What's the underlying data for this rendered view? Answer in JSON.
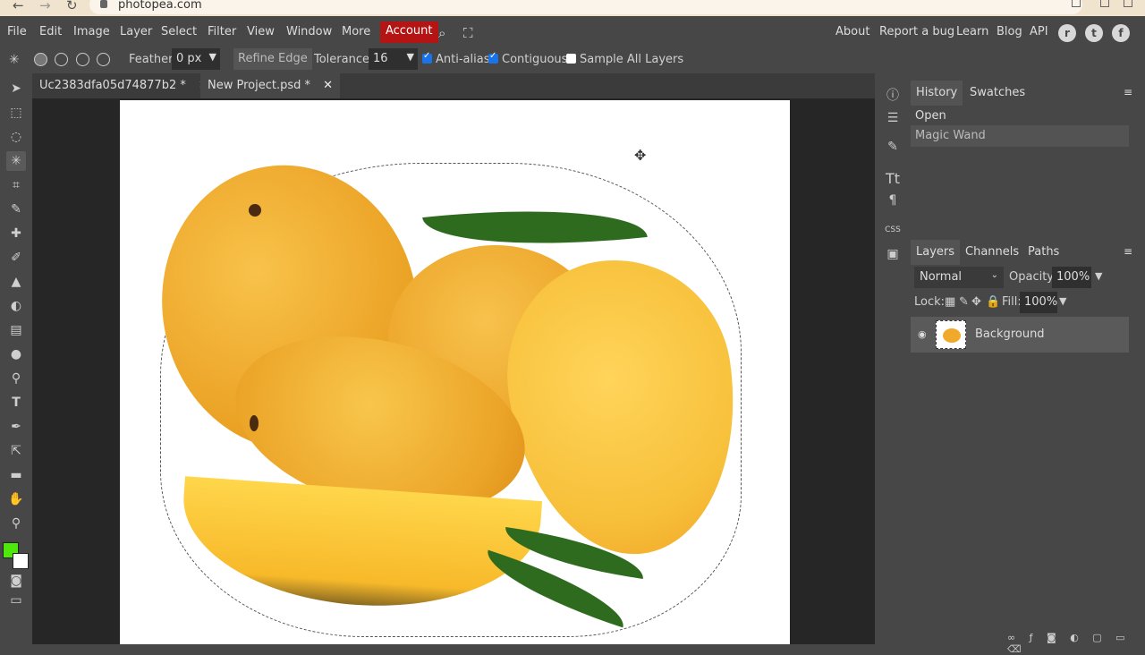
{
  "browser": {
    "url": "photopea.com"
  },
  "menu": {
    "items": [
      "File",
      "Edit",
      "Image",
      "Layer",
      "Select",
      "Filter",
      "View",
      "Window",
      "More"
    ],
    "account": "Account",
    "right_links": [
      "About",
      "Report a bug",
      "Learn",
      "Blog",
      "API"
    ]
  },
  "options": {
    "feather_label": "Feather:",
    "feather_value": "0 px",
    "refine_edge": "Refine Edge",
    "tolerance_label": "Tolerance:",
    "tolerance_value": "16",
    "antialias_label": "Anti-alias",
    "contiguous_label": "Contiguous",
    "sample_all_label": "Sample All Layers"
  },
  "tabs": [
    {
      "label": "Uc2383dfa05d74877b2",
      "modified": "*"
    },
    {
      "label": "New Project.psd",
      "modified": "*"
    }
  ],
  "history_panel": {
    "tabs": [
      "History",
      "Swatches"
    ],
    "items": [
      "Open",
      "Magic Wand"
    ]
  },
  "layers_panel": {
    "tabs": [
      "Layers",
      "Channels",
      "Paths"
    ],
    "blend_mode": "Normal",
    "opacity_label": "Opacity:",
    "opacity_value": "100%",
    "lock_label": "Lock:",
    "fill_label": "Fill:",
    "fill_value": "100%",
    "layers": [
      {
        "name": "Background"
      }
    ]
  },
  "colors": {
    "foreground": "#4ee80b",
    "background": "#ffffff",
    "account_bg": "#b51414"
  }
}
